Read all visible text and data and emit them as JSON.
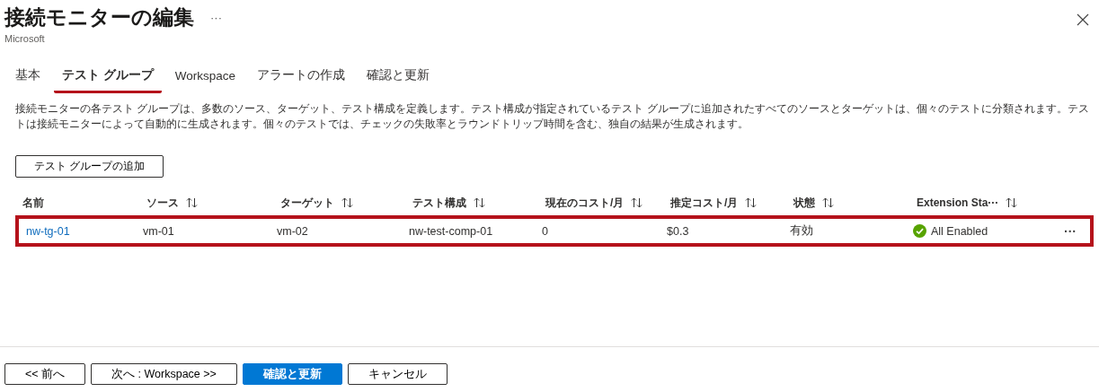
{
  "header": {
    "title": "接続モニターの編集",
    "subtitle": "Microsoft",
    "more": "···"
  },
  "tabs": [
    {
      "label": "基本",
      "selected": false
    },
    {
      "label": "テスト グループ",
      "selected": true
    },
    {
      "label": "Workspace",
      "selected": false
    },
    {
      "label": "アラートの作成",
      "selected": false
    },
    {
      "label": "確認と更新",
      "selected": false
    }
  ],
  "description": "接続モニターの各テスト グループは、多数のソース、ターゲット、テスト構成を定義します。テスト構成が指定されているテスト グループに追加されたすべてのソースとターゲットは、個々のテストに分類されます。テストは接続モニターによって自動的に生成されます。個々のテストでは、チェックの失敗率とラウンドトリップ時間を含む、独自の結果が生成されます。",
  "add_button": "テスト グループの追加",
  "table": {
    "columns": [
      {
        "label": "名前",
        "sortable": false
      },
      {
        "label": "ソース",
        "sortable": true
      },
      {
        "label": "ターゲット",
        "sortable": true
      },
      {
        "label": "テスト構成",
        "sortable": true
      },
      {
        "label": "現在のコスト/月",
        "sortable": true
      },
      {
        "label": "推定コスト/月",
        "sortable": true
      },
      {
        "label": "状態",
        "sortable": true
      },
      {
        "label": "Extension Sta···",
        "sortable": true
      }
    ],
    "rows": [
      {
        "highlighted": true,
        "name": "nw-tg-01",
        "source": "vm-01",
        "target": "vm-02",
        "config": "nw-test-comp-01",
        "current_cost": "0",
        "estimated_cost": "$0.3",
        "state": "有効",
        "extension_status": "All Enabled",
        "more": "···"
      }
    ]
  },
  "footer": [
    {
      "label": "<< 前へ",
      "kind": "default"
    },
    {
      "label": "次へ : Workspace >>",
      "kind": "default"
    },
    {
      "label": "確認と更新",
      "kind": "primary"
    },
    {
      "label": "キャンセル",
      "kind": "default"
    }
  ]
}
